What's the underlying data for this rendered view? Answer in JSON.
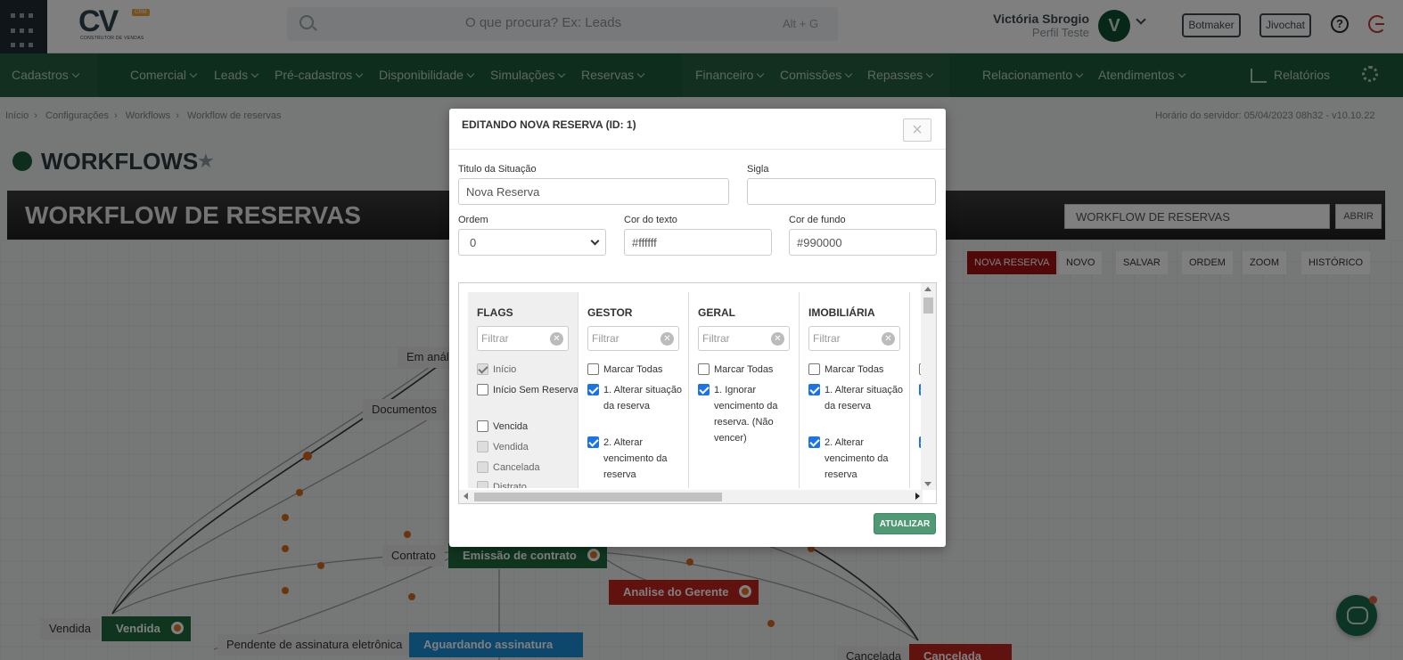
{
  "header": {
    "logo_text": "CV",
    "logo_badge": "CRM",
    "logo_sub": "CONSTRUTOR DE VENDAS",
    "search_placeholder": "O que procura? Ex: Leads",
    "search_shortcut": "Alt + G",
    "user_name": "Victória Sbrogio",
    "user_profile": "Perfil Teste",
    "avatar_letter": "V",
    "buttons": [
      "Botmaker",
      "Jivochat"
    ],
    "help_glyph": "?"
  },
  "nav": {
    "items": [
      "Cadastros",
      "Comercial",
      "Leads",
      "Pré-cadastros",
      "Disponibilidade",
      "Simulações",
      "Reservas",
      "Financeiro",
      "Comissões",
      "Repasses",
      "Relacionamento",
      "Atendimentos",
      "Relatórios"
    ],
    "colors": {
      "bar": "#1f5a3a",
      "segment": "#245f3f"
    }
  },
  "breadcrumb": [
    "Início",
    "Configurações",
    "Workflows",
    "Workflow de reservas"
  ],
  "breadcrumb_separator": "›",
  "server_time": "Horário do servidor: 05/04/2023 08h32 - v10.10.22",
  "page_title": "WORKFLOWS",
  "workflow": {
    "title": "WORKFLOW DE RESERVAS",
    "select_value": "WORKFLOW DE RESERVAS",
    "open_label": "ABRIR",
    "toolbar": [
      "NOVA RESERVA",
      "NOVO",
      "SALVAR",
      "ORDEM",
      "ZOOM",
      "HISTÓRICO"
    ],
    "canvas_labels": [
      "Em anál",
      "Documentos",
      "Contrato",
      "Vendida",
      "Pendente de assinatura eletrônica",
      "Cancelada"
    ],
    "canvas_nodes": [
      {
        "label": "Emissão de contrato",
        "color": "#1f6b3f"
      },
      {
        "label": "Analise do Gerente",
        "color": "#c0241f"
      },
      {
        "label": "Vendida",
        "color": "#1f6b3f"
      },
      {
        "label": "Aguardando assinatura",
        "color": "#1a8fd6"
      },
      {
        "label": "Cancelada",
        "color": "#c0241f"
      }
    ]
  },
  "modal": {
    "title": "EDITANDO NOVA RESERVA (ID: 1)",
    "close_glyph": "×",
    "fields": {
      "titulo_label": "Titulo da Situação",
      "titulo_value": "Nova Reserva",
      "sigla_label": "Sigla",
      "sigla_value": "",
      "ordem_label": "Ordem",
      "ordem_value": "0",
      "cor_texto_label": "Cor do texto",
      "cor_texto_value": "#ffffff",
      "cor_fundo_label": "Cor de fundo",
      "cor_fundo_value": "#990000"
    },
    "filter_placeholder": "Filtrar",
    "filter_clear_glyph": "✕",
    "columns": [
      {
        "name": "FLAGS",
        "items": [
          {
            "label": "Início",
            "checked": true,
            "disabled": true
          },
          {
            "label": "Início Sem Reserva",
            "checked": false,
            "disabled": false
          },
          {
            "label": "Vencida",
            "checked": false,
            "disabled": false
          },
          {
            "label": "Vendida",
            "checked": false,
            "disabled": true
          },
          {
            "label": "Cancelada",
            "checked": false,
            "disabled": true
          },
          {
            "label": "Distrato",
            "checked": false,
            "disabled": true
          }
        ]
      },
      {
        "name": "GESTOR",
        "items": [
          {
            "label": "Marcar Todas",
            "checked": false
          },
          {
            "label": "1. Alterar situação da reserva",
            "checked": true
          },
          {
            "label": "2. Alterar vencimento da reserva",
            "checked": true
          }
        ]
      },
      {
        "name": "GERAL",
        "items": [
          {
            "label": "Marcar Todas",
            "checked": false
          },
          {
            "label": "1. Ignorar vencimento da reserva. (Não vencer)",
            "checked": true
          }
        ]
      },
      {
        "name": "IMOBILIÁRIA",
        "items": [
          {
            "label": "Marcar Todas",
            "checked": false
          },
          {
            "label": "1. Alterar situação da reserva",
            "checked": true
          },
          {
            "label": "2. Alterar vencimento da reserva",
            "checked": true
          }
        ]
      }
    ],
    "update_label": "ATUALIZAR"
  }
}
